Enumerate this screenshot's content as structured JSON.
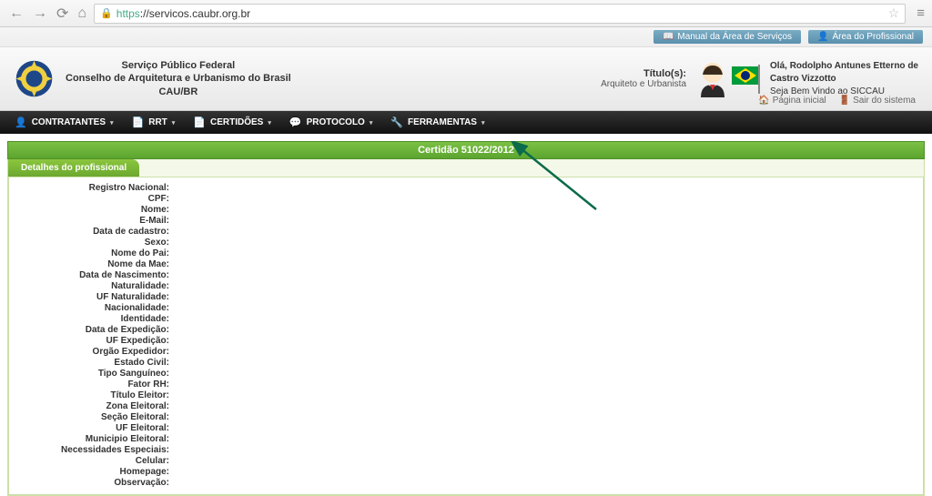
{
  "browser": {
    "url_proto": "https",
    "url_rest": "://servicos.caubr.org.br"
  },
  "top_links": {
    "manual": "Manual da Área de Serviços",
    "area": "Área do Profissional"
  },
  "header": {
    "org_line1": "Serviço Público Federal",
    "org_line2": "Conselho de Arquitetura e Urbanismo do Brasil",
    "org_line3": "CAU/BR",
    "titulos_label": "Título(s):",
    "titulos_value": "Arquiteto e Urbanista",
    "greeting_line1": "Olá, Rodolpho Antunes Etterno de",
    "greeting_line2": "Castro Vizzotto",
    "greeting_line3": "Seja Bem Vindo ao SICCAU",
    "pagina_inicial": "Página inicial",
    "sair": "Sair do sistema"
  },
  "menu": {
    "items": [
      {
        "label": "CONTRATANTES",
        "icon": "👤"
      },
      {
        "label": "RRT",
        "icon": "📄"
      },
      {
        "label": "CERTIDÕES",
        "icon": "📄"
      },
      {
        "label": "PROTOCOLO",
        "icon": "💬"
      },
      {
        "label": "FERRAMENTAS",
        "icon": "🔧"
      }
    ]
  },
  "green_bar": "Certidão 51022/2012",
  "tab_label": "Detalhes do profissional",
  "fields": [
    "Registro Nacional:",
    "CPF:",
    "Nome:",
    "E-Mail:",
    "Data de cadastro:",
    "Sexo:",
    "Nome do Pai:",
    "Nome da Mae:",
    "Data de Nascimento:",
    "Naturalidade:",
    "UF Naturalidade:",
    "Nacionalidade:",
    "Identidade:",
    "Data de Expedição:",
    "UF Expedição:",
    "Orgão Expedidor:",
    "Estado Civil:",
    "Tipo Sanguíneo:",
    "Fator RH:",
    "Título Eleitor:",
    "Zona Eleitoral:",
    "Seção Eleitoral:",
    "UF Eleitoral:",
    "Municipio Eleitoral:",
    "Necessidades Especiais:",
    "Celular:",
    "Homepage:",
    "Observação:"
  ]
}
